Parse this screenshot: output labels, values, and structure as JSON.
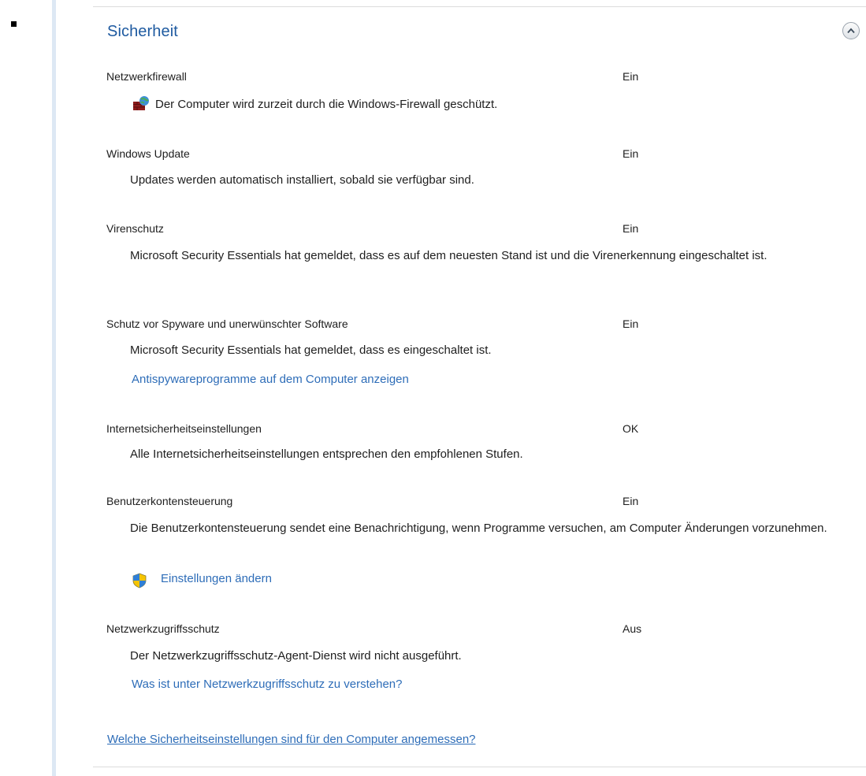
{
  "section": {
    "title": "Sicherheit"
  },
  "rows": [
    {
      "title": "Netzwerkfirewall",
      "status": "Ein",
      "description": "Der Computer wird zurzeit durch die Windows-Firewall geschützt.",
      "icon": "firewall-icon"
    },
    {
      "title": "Windows Update",
      "status": "Ein",
      "description": "Updates werden automatisch installiert, sobald sie verfügbar sind."
    },
    {
      "title": "Virenschutz",
      "status": "Ein",
      "description": "Microsoft Security Essentials hat gemeldet, dass es auf dem neuesten Stand ist und die Virenerkennung eingeschaltet ist."
    },
    {
      "title": "Schutz vor Spyware und unerwünschter Software",
      "status": "Ein",
      "description": "Microsoft Security Essentials hat gemeldet, dass es eingeschaltet ist.",
      "link": "Antispywareprogramme auf dem Computer anzeigen"
    },
    {
      "title": "Internetsicherheitseinstellungen",
      "status": "OK",
      "description": "Alle Internetsicherheitseinstellungen entsprechen den empfohlenen Stufen."
    },
    {
      "title": "Benutzerkontensteuerung",
      "status": "Ein",
      "description": "Die Benutzerkontensteuerung sendet eine Benachrichtigung, wenn Programme versuchen, am Computer Änderungen vorzunehmen.",
      "link": "Einstellungen ändern",
      "link_icon": "uac-shield-icon"
    },
    {
      "title": "Netzwerkzugriffsschutz",
      "status": "Aus",
      "description": "Der Netzwerkzugriffsschutz-Agent-Dienst wird nicht ausgeführt.",
      "link": "Was ist unter Netzwerkzugriffsschutz zu verstehen?"
    }
  ],
  "footer": {
    "link": "Welche Sicherheitseinstellungen sind für den Computer angemessen?"
  },
  "icons": {
    "collapse": "chevron-up-icon"
  },
  "colors": {
    "title": "#1e5aa0",
    "link": "#2e6db8",
    "text": "#1e1e1e"
  }
}
